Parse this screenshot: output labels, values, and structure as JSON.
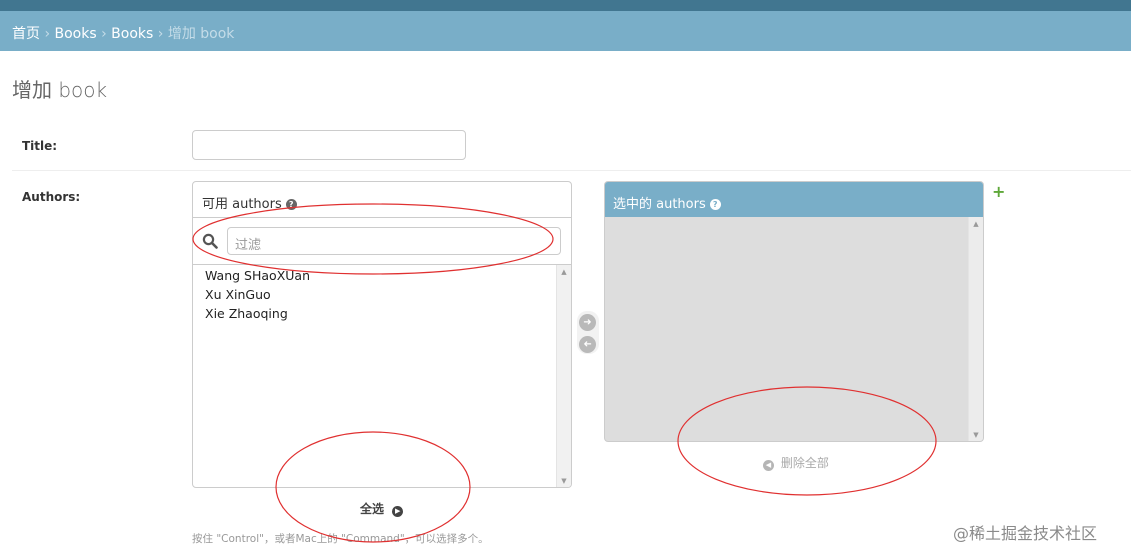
{
  "breadcrumbs": {
    "home": "首页",
    "app": "Books",
    "model": "Books",
    "separator": "›",
    "current": "增加 book"
  },
  "page": {
    "title": "增加 book"
  },
  "form": {
    "title_label": "Title:",
    "title_value": "",
    "authors_label": "Authors:"
  },
  "available": {
    "header": "可用 authors",
    "filter_placeholder": "过滤",
    "options": [
      "Wang SHaoXUan",
      "Xu XinGuo",
      "Xie Zhaoqing"
    ],
    "choose_all": "全选"
  },
  "chosen": {
    "header": "选中的 authors",
    "remove_all": "删除全部"
  },
  "help_text": "按住 \"Control\"，或者Mac上的 \"Command\"，可以选择多个。",
  "watermark": "@稀土掘金技术社区",
  "colors": {
    "header_bar": "#417690",
    "breadcrumb_bar": "#79aec8",
    "annotation": "#e03030",
    "add_icon": "#5fa83a"
  },
  "icons": {
    "help": "question-circle-icon",
    "search": "search-icon",
    "add": "plus-icon"
  }
}
